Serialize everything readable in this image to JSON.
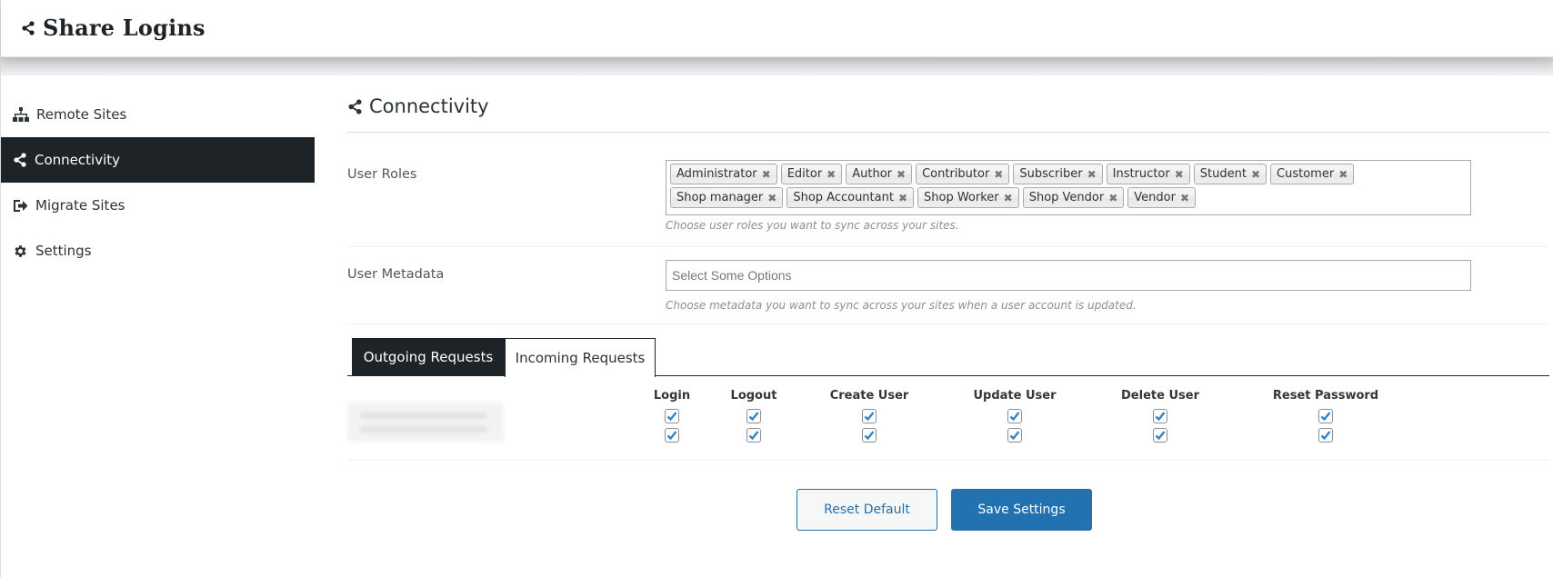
{
  "header": {
    "title": "Share Logins",
    "icon": "share-icon"
  },
  "sidebar": {
    "items": [
      {
        "label": "Remote Sites",
        "icon": "sitemap-icon",
        "active": false
      },
      {
        "label": "Connectivity",
        "icon": "share-icon",
        "active": true
      },
      {
        "label": "Migrate Sites",
        "icon": "sign-out-icon",
        "active": false
      },
      {
        "label": "Settings",
        "icon": "gear-icon",
        "active": false
      }
    ]
  },
  "main": {
    "title": "Connectivity",
    "title_icon": "share-icon",
    "user_roles": {
      "label": "User Roles",
      "selected": [
        "Administrator",
        "Editor",
        "Author",
        "Contributor",
        "Subscriber",
        "Instructor",
        "Student",
        "Customer",
        "Shop manager",
        "Shop Accountant",
        "Shop Worker",
        "Shop Vendor",
        "Vendor"
      ],
      "hint": "Choose user roles you want to sync across your sites."
    },
    "user_metadata": {
      "label": "User Metadata",
      "placeholder": "Select Some Options",
      "hint": "Choose metadata you want to sync across your sites when a user account is updated."
    },
    "tabs": [
      {
        "label": "Outgoing Requests",
        "active": false
      },
      {
        "label": "Incoming Requests",
        "active": true
      }
    ],
    "permissions": {
      "columns": [
        "Login",
        "Logout",
        "Create User",
        "Update User",
        "Delete User",
        "Reset Password"
      ],
      "rows": [
        {
          "site": "",
          "values": [
            true,
            true,
            true,
            true,
            true,
            true
          ]
        },
        {
          "site": "",
          "values": [
            true,
            true,
            true,
            true,
            true,
            true
          ]
        }
      ]
    },
    "buttons": {
      "reset": "Reset Default",
      "save": "Save Settings"
    }
  },
  "colors": {
    "dark": "#1d2327",
    "primary": "#2271b1",
    "check": "#3582c4"
  }
}
